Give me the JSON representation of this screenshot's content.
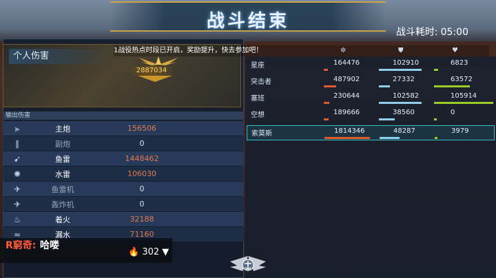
{
  "header": {
    "title": "战斗结束",
    "duration_label": "战斗耗时:",
    "duration_value": "05:00"
  },
  "ticker": "1战役热点时段已开启，奖励提升，快去参加吧！",
  "personal": {
    "label": "个人伤害",
    "total": "2887034"
  },
  "output": {
    "header": "输出伤害",
    "rows": [
      {
        "icon": "main-gun-icon",
        "name": "主炮",
        "value": "156506"
      },
      {
        "icon": "secondary-gun-icon",
        "name": "副炮",
        "value": "0"
      },
      {
        "icon": "torpedo-icon",
        "name": "鱼雷",
        "value": "1448462"
      },
      {
        "icon": "mine-icon",
        "name": "水雷",
        "value": "106030"
      },
      {
        "icon": "torpedo-bomber-icon",
        "name": "鱼雷机",
        "value": "0"
      },
      {
        "icon": "bomber-icon",
        "name": "轰炸机",
        "value": "0"
      },
      {
        "icon": "fire-icon",
        "name": "着火",
        "value": "32188"
      },
      {
        "icon": "flooding-icon",
        "name": "漏水",
        "value": "71160"
      }
    ]
  },
  "scoreboard": {
    "columns": [
      "damage-dealt-icon",
      "damage-taken-icon",
      "repair-icon"
    ],
    "rows": [
      {
        "name": "星座",
        "damage": "164476",
        "taken": "102910",
        "repair": "6823",
        "highlight": false
      },
      {
        "name": "突击者",
        "damage": "487902",
        "taken": "27332",
        "repair": "63572",
        "highlight": false
      },
      {
        "name": "塞班",
        "damage": "230644",
        "taken": "102582",
        "repair": "105914",
        "highlight": false
      },
      {
        "name": "空想",
        "damage": "189666",
        "taken": "38560",
        "repair": "0",
        "highlight": false
      },
      {
        "name": "索莫斯",
        "damage": "1814346",
        "taken": "48287",
        "repair": "3979",
        "highlight": true
      }
    ]
  },
  "chat": {
    "user": "R窮奇:",
    "message": "哈喽",
    "viewers": "302"
  },
  "colors": {
    "damage_bar": "#e05a30",
    "taken_bar": "#8fd0ee",
    "repair_bar": "#9ccc2c",
    "highlight": "#38c0c8"
  }
}
